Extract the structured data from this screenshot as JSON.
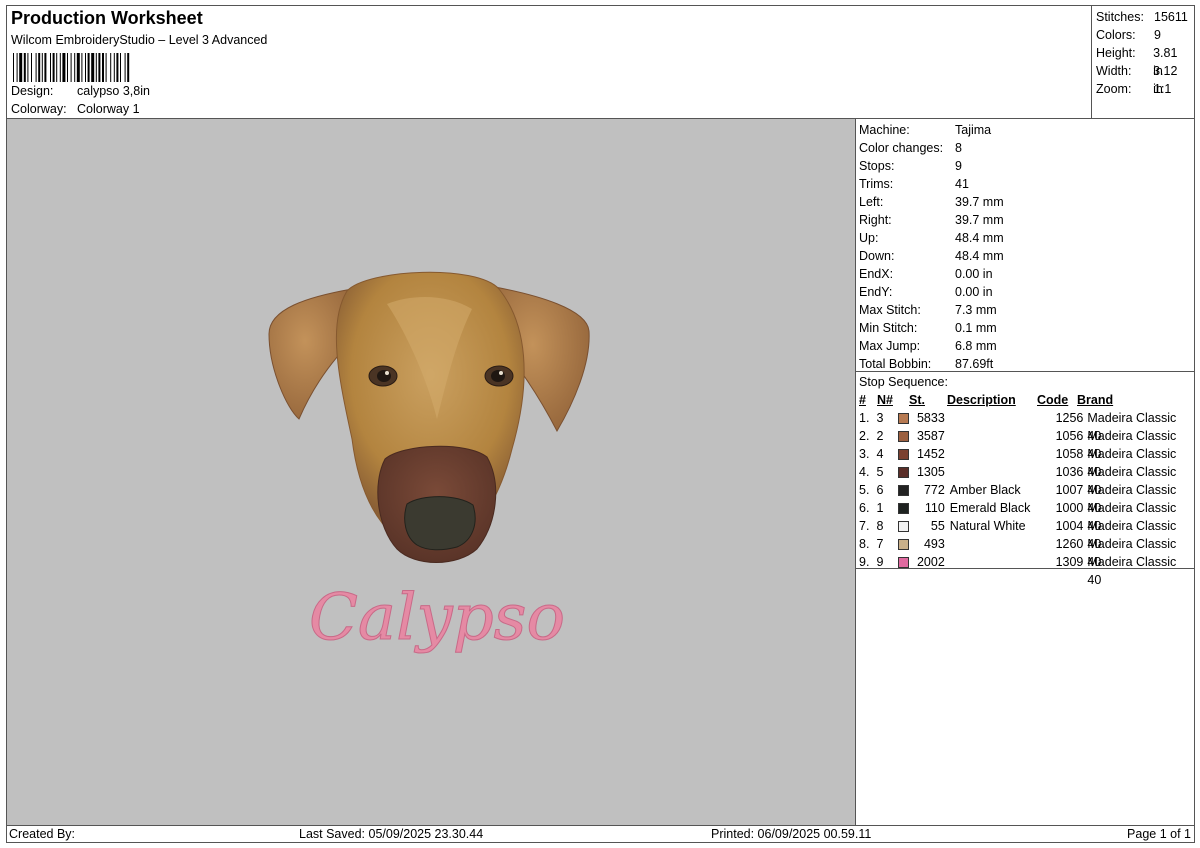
{
  "header": {
    "title": "Production Worksheet",
    "subtitle": "Wilcom EmbroideryStudio – Level 3 Advanced",
    "design_label": "Design:",
    "design_value": "calypso 3,8in",
    "colorway_label": "Colorway:",
    "colorway_value": "Colorway 1"
  },
  "stats": [
    {
      "label": "Stitches:",
      "value": "15611"
    },
    {
      "label": "Colors:",
      "value": "9"
    },
    {
      "label": "Height:",
      "value": "3.81 in"
    },
    {
      "label": "Width:",
      "value": "3.12 in"
    },
    {
      "label": "Zoom:",
      "value": "1:1"
    }
  ],
  "machine_info": [
    {
      "label": "Machine:",
      "value": "Tajima"
    },
    {
      "label": "Color changes:",
      "value": "8"
    },
    {
      "label": "Stops:",
      "value": "9"
    },
    {
      "label": "Trims:",
      "value": "41"
    },
    {
      "label": "Left:",
      "value": "39.7 mm"
    },
    {
      "label": "Right:",
      "value": "39.7 mm"
    },
    {
      "label": "Up:",
      "value": "48.4 mm"
    },
    {
      "label": "Down:",
      "value": "48.4 mm"
    },
    {
      "label": "EndX:",
      "value": "0.00 in"
    },
    {
      "label": "EndY:",
      "value": "0.00 in"
    },
    {
      "label": "Max Stitch:",
      "value": "7.3 mm"
    },
    {
      "label": "Min Stitch:",
      "value": "0.1 mm"
    },
    {
      "label": "Max Jump:",
      "value": "6.8 mm"
    },
    {
      "label": "Total Bobbin:",
      "value": "87.69ft"
    }
  ],
  "stop_sequence": {
    "title": "Stop Sequence:",
    "headers": {
      "idx": "#",
      "n": "N#",
      "st": "St.",
      "desc": "Description",
      "code": "Code",
      "brand": "Brand"
    },
    "rows": [
      {
        "idx": "1.",
        "n": "3",
        "color": "#b77a52",
        "st": "5833",
        "desc": "",
        "code": "1256",
        "brand": "Madeira Classic 40"
      },
      {
        "idx": "2.",
        "n": "2",
        "color": "#9c6040",
        "st": "3587",
        "desc": "",
        "code": "1056",
        "brand": "Madeira Classic 40"
      },
      {
        "idx": "3.",
        "n": "4",
        "color": "#7a4030",
        "st": "1452",
        "desc": "",
        "code": "1058",
        "brand": "Madeira Classic 40"
      },
      {
        "idx": "4.",
        "n": "5",
        "color": "#5a2e28",
        "st": "1305",
        "desc": "",
        "code": "1036",
        "brand": "Madeira Classic 40"
      },
      {
        "idx": "5.",
        "n": "6",
        "color": "#222222",
        "st": "772",
        "desc": "Amber Black",
        "code": "1007",
        "brand": "Madeira Classic 40"
      },
      {
        "idx": "6.",
        "n": "1",
        "color": "#1e2220",
        "st": "110",
        "desc": "Emerald Black",
        "code": "1000",
        "brand": "Madeira Classic 40"
      },
      {
        "idx": "7.",
        "n": "8",
        "color": "#f2f2f2",
        "st": "55",
        "desc": "Natural White",
        "code": "1004",
        "brand": "Madeira Classic 40"
      },
      {
        "idx": "8.",
        "n": "7",
        "color": "#c9b08a",
        "st": "493",
        "desc": "",
        "code": "1260",
        "brand": "Madeira Classic 40"
      },
      {
        "idx": "9.",
        "n": "9",
        "color": "#e06aa0",
        "st": "2002",
        "desc": "",
        "code": "1309",
        "brand": "Madeira Classic 40"
      }
    ]
  },
  "design": {
    "name_text": "Calypso",
    "name_color": "#e58aa4",
    "fur_color": "#b98a4e",
    "fur_dark": "#8a5f35",
    "muzzle_color": "#6e4234",
    "nose_color": "#3b3a30"
  },
  "footer": {
    "created_by": "Created By:",
    "last_saved": "Last Saved: 05/09/2025 23.30.44",
    "printed": "Printed: 06/09/2025 00.59.11",
    "page": "Page 1 of 1"
  }
}
